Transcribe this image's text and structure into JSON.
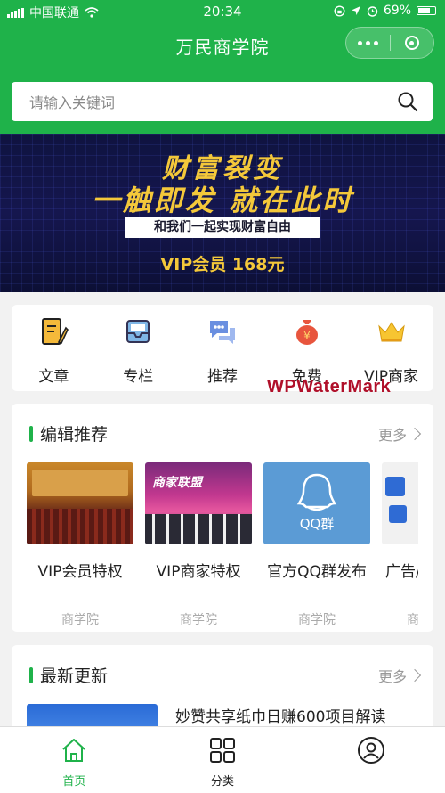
{
  "status_bar": {
    "carrier": "中国联通",
    "time": "20:34",
    "battery": "69%"
  },
  "title_bar": {
    "title": "万民商学院"
  },
  "search": {
    "placeholder": "请输入关键词"
  },
  "banner": {
    "headline": "财富裂变",
    "subheadline": "一触即发 就在此时",
    "tagline": "和我们一起实现财富自由",
    "offer": "VIP会员 168元"
  },
  "quick_nav": [
    {
      "label": "文章",
      "icon": "article-icon"
    },
    {
      "label": "专栏",
      "icon": "column-icon"
    },
    {
      "label": "推荐",
      "icon": "chat-icon"
    },
    {
      "label": "免费",
      "icon": "money-bag-icon"
    },
    {
      "label": "VIP商家",
      "icon": "crown-icon"
    }
  ],
  "watermark": "WPWaterMark",
  "recommend": {
    "title": "编辑推荐",
    "more": "更多",
    "items": [
      {
        "title": "VIP会员特权",
        "source": "商学院"
      },
      {
        "title": "VIP商家特权",
        "source": "商学院"
      },
      {
        "title": "官方QQ群发布",
        "source": "商学院",
        "thumb_text": "QQ群"
      },
      {
        "title": "广告/",
        "source": "商"
      }
    ]
  },
  "latest": {
    "title": "最新更新",
    "more": "更多",
    "first_item": "妙赞共享纸巾日赚600项目解读"
  },
  "tabs": [
    {
      "label": "首页",
      "icon": "home-icon",
      "active": true
    },
    {
      "label": "分类",
      "icon": "grid-icon",
      "active": false
    },
    {
      "label": "",
      "icon": "user-icon",
      "active": false
    }
  ],
  "colors": {
    "brand": "#1fb24a",
    "banner_gold": "#f4c83a",
    "watermark": "#b0102a"
  }
}
